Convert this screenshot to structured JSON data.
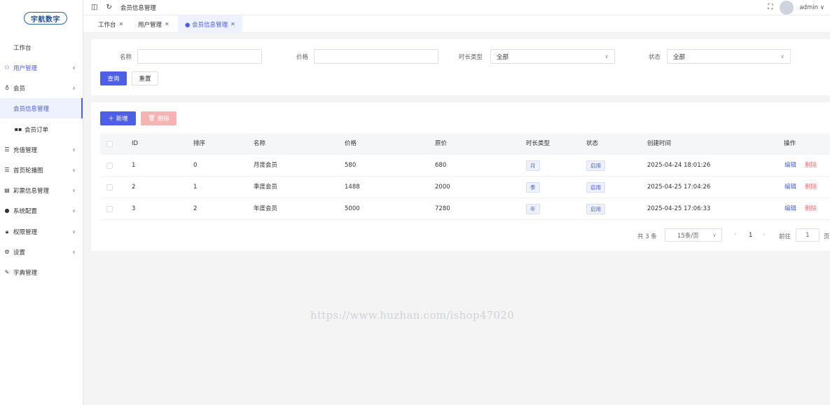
{
  "logo": {
    "text": "宇航数字"
  },
  "header": {
    "breadcrumb": "会员信息管理",
    "user": "admin",
    "user_chevron": "∨"
  },
  "tabs": [
    {
      "label": "工作台",
      "close": "✕"
    },
    {
      "label": "用户管理",
      "close": "✕"
    },
    {
      "label": "● 会员信息管理",
      "close": "✕"
    }
  ],
  "sidebar": {
    "items": [
      {
        "label": "工作台"
      },
      {
        "label": "用户管理",
        "chev": "∨"
      },
      {
        "label": "会员",
        "chev": "∧"
      },
      {
        "label": "会员信息管理"
      },
      {
        "label": "会员订单"
      },
      {
        "label": "充值管理",
        "chev": "∨"
      },
      {
        "label": "首页轮播图",
        "chev": "∨"
      },
      {
        "label": "彩票信息管理",
        "chev": "∨"
      },
      {
        "label": "系统配置",
        "chev": "∨"
      },
      {
        "label": "权限管理",
        "chev": "∨"
      },
      {
        "label": "设置",
        "chev": "∨"
      },
      {
        "label": "字典管理"
      }
    ]
  },
  "search": {
    "name_label": "名称",
    "name_value": "",
    "price_label": "价格",
    "price_value": "",
    "duration_label": "时长类型",
    "duration_value": "全部",
    "status_label": "状态",
    "status_value": "全部",
    "query_button": "查询",
    "reset_button": "重置"
  },
  "toolbar": {
    "add_button": "＋ 新增",
    "delete_button": "删除"
  },
  "table": {
    "columns": [
      "ID",
      "排序",
      "名称",
      "价格",
      "原价",
      "时长类型",
      "状态",
      "创建时间",
      "操作"
    ],
    "rows": [
      {
        "id": "1",
        "sort": "0",
        "name": "月度会员",
        "price": "580",
        "original": "680",
        "duration": "月",
        "status": "启用",
        "created": "2025-04-24 18:01:26",
        "edit": "编辑",
        "delete": "删除"
      },
      {
        "id": "2",
        "sort": "1",
        "name": "季度会员",
        "price": "1488",
        "original": "2000",
        "duration": "季",
        "status": "启用",
        "created": "2025-04-25 17:04:26",
        "edit": "编辑",
        "delete": "删除"
      },
      {
        "id": "3",
        "sort": "2",
        "name": "年度会员",
        "price": "5000",
        "original": "7280",
        "duration": "年",
        "status": "启用",
        "created": "2025-04-25 17:06:33",
        "edit": "编辑",
        "delete": "删除"
      }
    ]
  },
  "pagination": {
    "total": "共 3 条",
    "page_size": "15条/页",
    "prev": "‹",
    "current": "1",
    "next": "›",
    "goto_label": "前往",
    "goto_value": "1",
    "page_suffix": "页"
  },
  "watermark": "https://www.huzhan.com/ishop47020",
  "colors": {
    "primary": "#4d5fe6",
    "danger": "#f56c6c"
  }
}
